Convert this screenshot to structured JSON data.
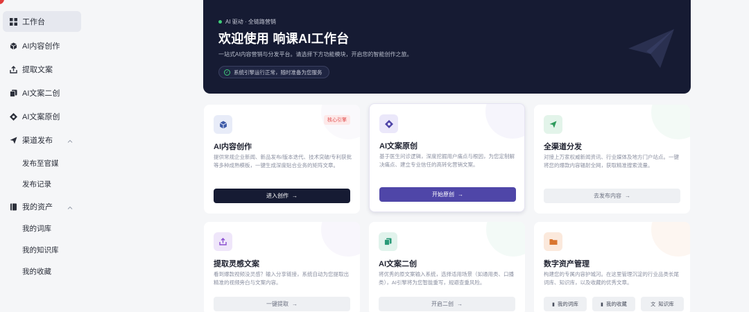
{
  "sidebar": {
    "items": [
      {
        "label": "工作台",
        "icon": "grid-icon"
      },
      {
        "label": "AI内容创作",
        "icon": "cube-icon"
      },
      {
        "label": "提取文案",
        "icon": "upload-icon"
      },
      {
        "label": "AI文案二创",
        "icon": "copy-icon"
      },
      {
        "label": "AI文案原创",
        "icon": "target-icon"
      },
      {
        "label": "渠道发布",
        "icon": "send-icon"
      },
      {
        "label": "我的资产",
        "icon": "book-icon"
      }
    ],
    "publish_sub": [
      "发布至官媒",
      "发布记录"
    ],
    "assets_sub": [
      "我的词库",
      "我的知识库",
      "我的收藏"
    ]
  },
  "hero": {
    "tag": "AI 驱动 · 全链路营销",
    "title": "欢迎使用 响课AI工作台",
    "subtitle": "一站式AI内容营销与分发平台。请选择下方功能模块，开启您的智能创作之旅。",
    "status": "系统引擎运行正常，随时准备为您服务"
  },
  "cards": [
    {
      "title": "AI内容创作",
      "badge": "核心引擎",
      "desc": "提供常规企业新闻、新品发布/版本迭代、技术突破/专利获批等多种成熟模板，一键生成深度贴合业务的矩阵文章。",
      "button": "进入创作"
    },
    {
      "title": "AI文案原创",
      "desc": "基于医生问诊逻辑，深度挖掘用户痛点与根因，为您定制解决痛点、建立专业信任的高转化营销文案。",
      "button": "开始原创"
    },
    {
      "title": "全渠道分发",
      "desc": "对接上万家权威新闻资讯、行业媒体及地方门户站点。一键将您的爆款内容辐射全网，获取精准搜索流量。",
      "button": "去发布内容"
    },
    {
      "title": "提取灵感文案",
      "desc": "看到爆款视频没灵感？输入分享链接，系统自动为您提取出精准的视频旁白与文案内容。",
      "button": "一键提取"
    },
    {
      "title": "AI文案二创",
      "desc": "将优秀的原文案输入系统，选择适用场景（如通用类、口播类），AI引擎将为您智能重写，规避查重风险。",
      "button": "开启二创"
    },
    {
      "title": "数字资产管理",
      "desc": "构建您的专属内容护城河。在这里管理沉淀的行业品类长尾词库、知识库，以及收藏的优秀文章。",
      "buttons": [
        "我的词库",
        "我的收藏",
        "知识库"
      ]
    }
  ],
  "colors": {
    "hero_bg": "#161b33",
    "accent_purple": "#4f46a8",
    "badge_red": "#e14b4b"
  }
}
